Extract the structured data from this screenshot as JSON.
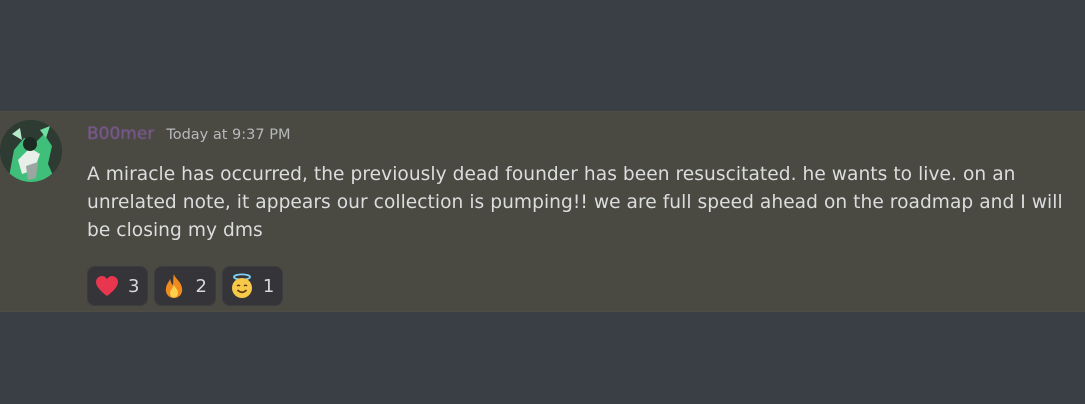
{
  "message": {
    "username": "B00mer",
    "timestamp": "Today at 9:37 PM",
    "content": "A miracle has occurred, the previously dead founder has been resuscitated. he wants to live. on an unrelated note, it appears our collection is pumping!! we are full speed ahead on the roadmap and I will be closing my dms",
    "reactions": [
      {
        "icon": "heart-icon",
        "count": "3"
      },
      {
        "icon": "fire-icon",
        "count": "2"
      },
      {
        "icon": "halo-smile-icon",
        "count": "1"
      }
    ]
  },
  "colors": {
    "background": "#3a3e45",
    "message_highlight": "#4a4942",
    "username": "#8e5fb0",
    "text": "#dcddde",
    "reaction_bg": "#353539"
  }
}
